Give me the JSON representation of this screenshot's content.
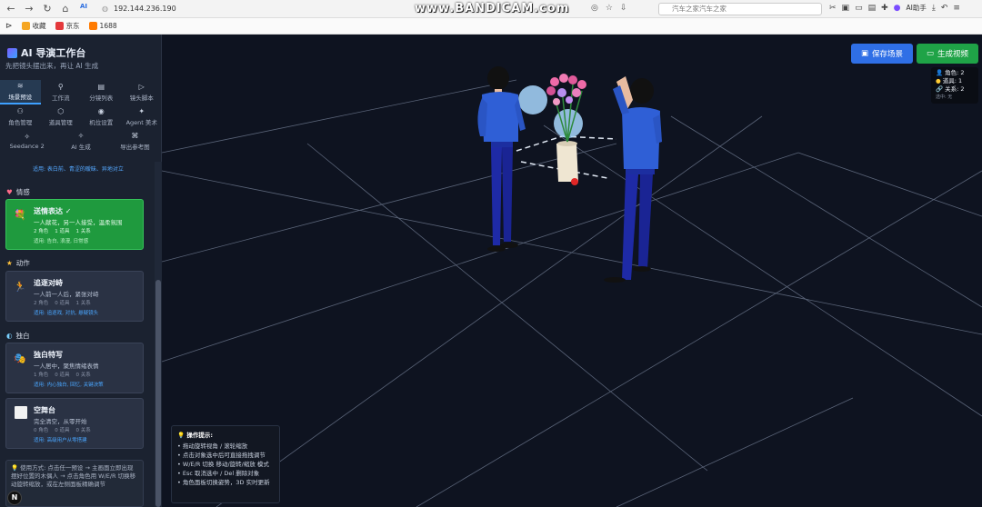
{
  "browser": {
    "url": "192.144.236.190",
    "watermark": "www.BANDICAM.com",
    "search_placeholder": "汽车之家汽车之家",
    "ai_helper": "AI助手"
  },
  "bookmarks": [
    {
      "label": "收藏",
      "color": "#f5a623"
    },
    {
      "label": "京东",
      "color": "#e4393c"
    },
    {
      "label": "1688",
      "color": "#ff7a00"
    }
  ],
  "sidebar": {
    "title": "AI 导演工作台",
    "subtitle": "先把镜头摆出来，再让 AI 生成",
    "tabs_row1": [
      {
        "icon": "≋",
        "label": "场景预设"
      },
      {
        "icon": "⚲",
        "label": "工作流"
      },
      {
        "icon": "▤",
        "label": "分镜列表"
      },
      {
        "icon": "▷",
        "label": "镜头脚本"
      }
    ],
    "tabs_row2": [
      {
        "icon": "⚇",
        "label": "角色管理"
      },
      {
        "icon": "⬡",
        "label": "道具管理"
      },
      {
        "icon": "◉",
        "label": "机位设置"
      },
      {
        "icon": "✦",
        "label": "Agent 美术"
      }
    ],
    "tabs_row3": [
      {
        "icon": "✧",
        "label": "Seedance 2"
      },
      {
        "icon": "✧",
        "label": "AI 生成"
      },
      {
        "icon": "⌘",
        "label": "导出参考图"
      }
    ],
    "clipped_tags": "适用: 表白前、青涩的暧昧、异地对立",
    "sections": {
      "romance": "情感",
      "action": "动作",
      "mono": "独白"
    },
    "cards": [
      {
        "icon": "💐",
        "title": "送情表达",
        "desc": "一人献花，另一人接受，温柔氛围",
        "meta": [
          "2 角色",
          "1 道具",
          "1 关系"
        ],
        "tags": "适用: 告白, 浪漫, 日常感"
      },
      {
        "icon": "🏃",
        "title": "追逐对峙",
        "desc": "一人前一人后，紧张对峙",
        "meta": [
          "2 角色",
          "0 道具",
          "1 关系"
        ],
        "tags": "适用: 追逐戏, 对抗, 悬疑镜头"
      },
      {
        "icon": "🎭",
        "title": "独白特写",
        "desc": "一人居中，聚焦情绪表情",
        "meta": [
          "1 角色",
          "0 道具",
          "0 关系"
        ],
        "tags": "适用: 内心独白, 回忆, 关键决策"
      },
      {
        "icon": "",
        "title": "空舞台",
        "desc": "完全清空，从零开始",
        "meta": [
          "0 角色",
          "0 道具",
          "0 关系"
        ],
        "tags": "适用: 高级用户从零搭建"
      }
    ],
    "usage": "💡 使用方式: 点击任一预设 → 主画面立即出现摆好位置的木偶人 → 点击角色用 W/E/R 切换移动旋转缩放，或在左侧面板精确调节"
  },
  "toolbar": {
    "save_label": "保存场景",
    "generate_label": "生成视频"
  },
  "stats": {
    "roles": "角色: 2",
    "props": "道具: 1",
    "relations": "关系: 2",
    "selected": "选中: 无"
  },
  "tips": {
    "title": "操作提示:",
    "lines": [
      "• 拖动旋转视角 / 滚轮缩放",
      "• 点击对象选中后可直接拖拽调节",
      "• W/E/R 切换 移动/旋转/缩放 模式",
      "• Esc 取消选中 / Del 删除对象",
      "• 角色面板切换姿势，3D 实时更新"
    ]
  },
  "colors": {
    "accent_blue": "#2f6fe6",
    "accent_green": "#1fa347",
    "sidebar_bg": "#1b2230",
    "viewport_bg": "#0e1320"
  }
}
